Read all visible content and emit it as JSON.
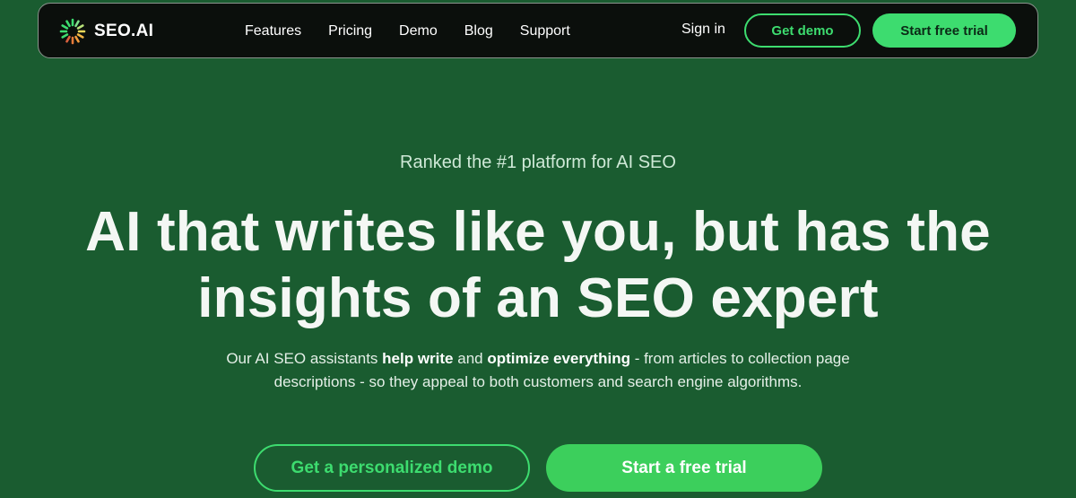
{
  "nav": {
    "logo_text": "SEO.AI",
    "links": [
      "Features",
      "Pricing",
      "Demo",
      "Blog",
      "Support"
    ],
    "sign_in": "Sign in",
    "get_demo": "Get demo",
    "start_trial": "Start free trial"
  },
  "hero": {
    "eyebrow": "Ranked the #1 platform for AI SEO",
    "headline_line1": "AI that writes like you, but has the",
    "headline_line2": "insights of an SEO expert",
    "sub_part1": "Our AI SEO assistants ",
    "sub_bold1": "help write",
    "sub_part2": " and ",
    "sub_bold2": "optimize everything",
    "sub_part3": " - from articles to collection page descriptions - so they appeal to both customers and search engine algorithms.",
    "cta_demo": "Get a personalized demo",
    "cta_trial": "Start a free trial"
  },
  "colors": {
    "background": "#1a5c30",
    "navbar": "#0b0f0c",
    "accent": "#3ddc6f"
  },
  "icons": {
    "logo": "sunburst-logo-icon"
  }
}
